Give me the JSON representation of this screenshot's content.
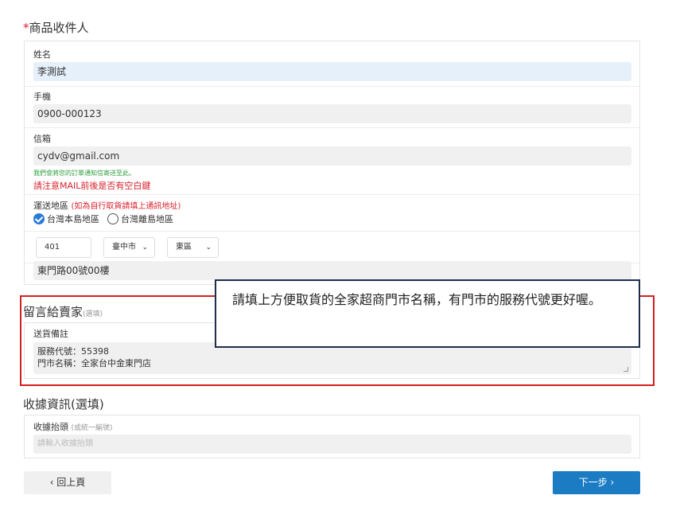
{
  "recipient": {
    "title_required_mark": "*",
    "title": "商品收件人",
    "name_label": "姓名",
    "name_value": "李測試",
    "phone_label": "手機",
    "phone_value": "0900-000123",
    "email_label": "信箱",
    "email_value": "cydv@gmail.com",
    "email_note": "我們會將您的訂單通知信寄送至此。",
    "email_warning": "請注意MAIL前後是否有空白鍵",
    "region_label": "運送地區",
    "region_hint": "(如為自行取貨請填上通訊地址)",
    "region_option_main": "台灣本島地區",
    "region_option_island": "台灣離島地區",
    "zip_value": "401",
    "city_value": "臺中市",
    "district_value": "東區",
    "address_value": "東門路00號00樓"
  },
  "seller_message": {
    "title": "留言給賣家",
    "optional": "(選填)",
    "note_label": "送貨備註",
    "note_line1": "服務代號：55398",
    "note_line2": "門市名稱：全家台中金東門店"
  },
  "callout_text": "請填上方便取貨的全家超商門市名稱，有門市的服務代號更好喔。",
  "receipt": {
    "title": "收據資訊(選填)",
    "header_label": "收據抬頭",
    "header_hint": "(或統一編號)",
    "header_placeholder": "請輸入收據抬頭"
  },
  "nav": {
    "back_label": "‹ 回上頁",
    "next_label": "下一步 ›"
  },
  "colors": {
    "accent_blue": "#1b7cc4",
    "warning_red": "#d9232e",
    "note_green": "#2e9e3c",
    "highlight_border": "#d42020"
  }
}
